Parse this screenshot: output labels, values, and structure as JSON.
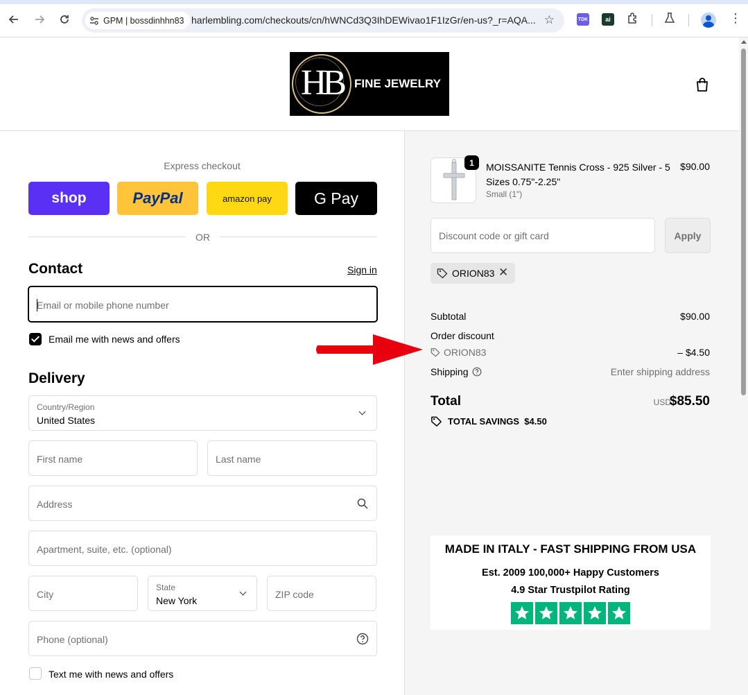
{
  "browser": {
    "site_chip": "GPM | bossdinhhn83",
    "url": "harlembling.com/checkouts/cn/hWNCd3Q3IhDEWivao1F1IzGr/en-us?_r=AQA...",
    "ext_tdk": "TDK",
    "ext_ai": "ai"
  },
  "header": {
    "logo_monogram": "HB",
    "logo_text": "FINE JEWELRY"
  },
  "express": {
    "title": "Express checkout",
    "shop_label": "shop",
    "paypal_label": "PayPal",
    "amazon_label": "amazon pay",
    "gpay_label": "G Pay",
    "or_label": "OR"
  },
  "contact": {
    "title": "Contact",
    "signin": "Sign in",
    "email_placeholder": "Email or mobile phone number",
    "newsletter_label": "Email me with news and offers",
    "newsletter_checked": true
  },
  "delivery": {
    "title": "Delivery",
    "country_label": "Country/Region",
    "country_value": "United States",
    "first_name_placeholder": "First name",
    "last_name_placeholder": "Last name",
    "address_placeholder": "Address",
    "apartment_placeholder": "Apartment, suite, etc. (optional)",
    "city_placeholder": "City",
    "state_label": "State",
    "state_value": "New York",
    "zip_placeholder": "ZIP code",
    "phone_placeholder": "Phone (optional)",
    "sms_label": "Text me with news and offers",
    "sms_checked": false
  },
  "summary": {
    "item": {
      "quantity": "1",
      "name": "MOISSANITE Tennis Cross - 925 Silver - 5 Sizes 0.75\"-2.25\"",
      "variant": "Small (1\")",
      "price": "$90.00"
    },
    "discount_placeholder": "Discount code or gift card",
    "apply_label": "Apply",
    "applied_code": "ORION83",
    "subtotal_label": "Subtotal",
    "subtotal_value": "$90.00",
    "order_discount_label": "Order discount",
    "discount_code": "ORION83",
    "discount_value": "– $4.50",
    "shipping_label": "Shipping",
    "shipping_value": "Enter shipping address",
    "total_label": "Total",
    "total_currency": "USD",
    "total_value": "$85.50",
    "savings_label": "TOTAL SAVINGS",
    "savings_value": "$4.50"
  },
  "banner": {
    "line1": "MADE IN ITALY - FAST SHIPPING FROM USA",
    "line2": "Est. 2009 100,000+ Happy Customers",
    "line3": "4.9 Star Trustpilot Rating",
    "rating_stars": 5
  },
  "colors": {
    "shop": "#5a31f4",
    "paypal": "#ffc439",
    "amazon": "#ffd814",
    "trustpilot": "#00b67a",
    "arrow": "#e8000f"
  }
}
